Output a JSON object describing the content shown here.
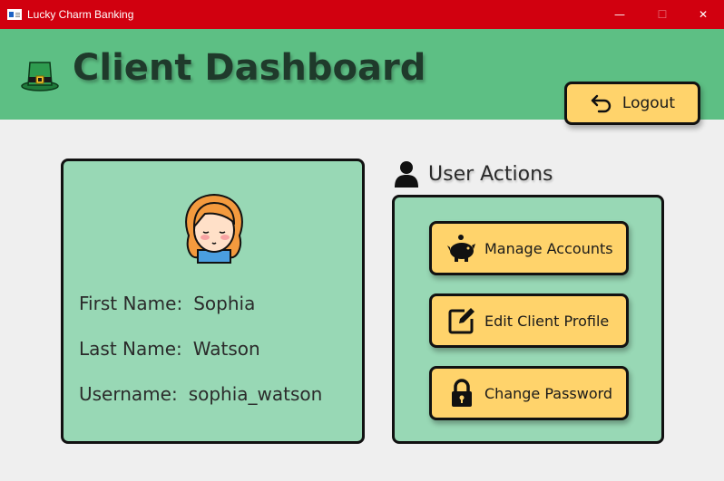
{
  "window": {
    "title": "Lucky Charm Banking",
    "controls": {
      "minimize": "—",
      "maximize": "☐",
      "close": "✕"
    }
  },
  "header": {
    "icon": "leprechaun-hat-icon",
    "title": "Client Dashboard",
    "logout_label": "Logout",
    "logout_icon": "undo-arrow-icon"
  },
  "profile": {
    "avatar": "user-avatar",
    "first_name_label": "First Name:",
    "first_name_value": "Sophia",
    "last_name_label": "Last Name:",
    "last_name_value": "Watson",
    "username_label": "Username:",
    "username_value": "sophia_watson"
  },
  "actions": {
    "heading": "User Actions",
    "heading_icon": "user-icon",
    "buttons": [
      {
        "label": "Manage Accounts",
        "icon": "piggy-bank-icon"
      },
      {
        "label": "Edit Client Profile",
        "icon": "edit-icon"
      },
      {
        "label": "Change Password",
        "icon": "lock-icon"
      }
    ]
  },
  "colors": {
    "titlebar": "#d1000f",
    "header": "#5dbf84",
    "card": "#98d8b5",
    "button": "#ffd36b",
    "background": "#efefef"
  }
}
